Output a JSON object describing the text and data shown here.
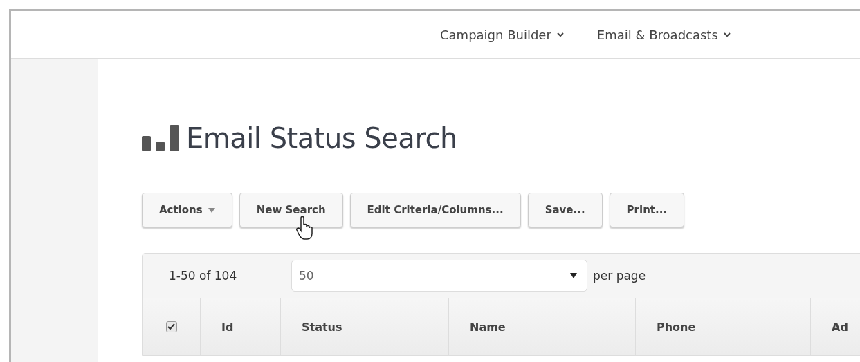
{
  "top_nav": [
    {
      "label": "Campaign Builder"
    },
    {
      "label": "Email & Broadcasts"
    }
  ],
  "page_title": "Email Status Search",
  "toolbar": [
    {
      "label": "Actions",
      "kind": "dropdown"
    },
    {
      "label": "New Search",
      "kind": "plain"
    },
    {
      "label": "Edit Criteria/Columns...",
      "kind": "plain"
    },
    {
      "label": "Save...",
      "kind": "plain"
    },
    {
      "label": "Print...",
      "kind": "plain"
    }
  ],
  "pagination": {
    "range": "1-50 of 104",
    "per_page": "50",
    "per_page_label": "per page"
  },
  "table": {
    "select_all_checked": true,
    "columns": [
      "Id",
      "Status",
      "Name",
      "Phone",
      "Ad"
    ]
  }
}
